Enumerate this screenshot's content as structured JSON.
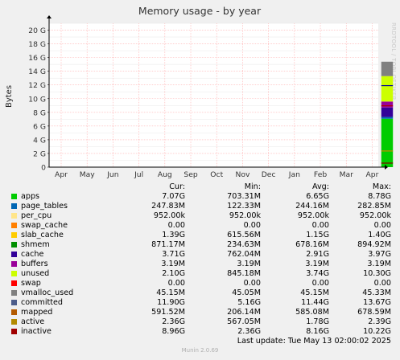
{
  "title": "Memory usage - by year",
  "ylabel": "Bytes",
  "watermark": "RRDTOOL / TOBI OETIKER",
  "chart_data": {
    "type": "area",
    "title": "Memory usage - by year",
    "ylabel": "Bytes",
    "ylim": [
      0,
      21
    ],
    "y_ticks": [
      "0",
      "2 G",
      "4 G",
      "6 G",
      "8 G",
      "10 G",
      "12 G",
      "14 G",
      "16 G",
      "18 G",
      "20 G"
    ],
    "y_tick_values": [
      0,
      2,
      4,
      6,
      8,
      10,
      12,
      14,
      16,
      18,
      20
    ],
    "y_unit": "G",
    "x_ticks": [
      "Apr",
      "May",
      "Jun",
      "Jul",
      "Aug",
      "Sep",
      "Oct",
      "Nov",
      "Dec",
      "Jan",
      "Feb",
      "Mar",
      "Apr"
    ],
    "grid": true,
    "data_window": {
      "start_month_index": 12.35,
      "end_month_index": 12.8
    },
    "stack_at_end": [
      {
        "name": "apps",
        "color": "#00cc00",
        "value": 7.07
      },
      {
        "name": "page_tables",
        "color": "#0066b3",
        "value": 0.248
      },
      {
        "name": "per_cpu",
        "color": "#ff8000",
        "value": 0.001
      },
      {
        "name": "swap_cache",
        "color": "#ffcc00",
        "value": 0.0
      },
      {
        "name": "slab_cache",
        "color": "#330099",
        "value": 1.39
      },
      {
        "name": "shmem",
        "color": "#990099",
        "value": 0.871
      },
      {
        "name": "cache",
        "color": "#ccff00",
        "value": 3.71
      },
      {
        "name": "buffers",
        "color": "#ff0000",
        "value": 0.003
      },
      {
        "name": "unused",
        "color": "#808080",
        "value": 2.1
      }
    ],
    "lines": [
      {
        "name": "committed",
        "color": "#000099",
        "value": 11.9
      },
      {
        "name": "mapped",
        "color": "#800000",
        "value": 0.59
      },
      {
        "name": "active",
        "color": "#cc8800",
        "value": 2.36
      },
      {
        "name": "inactive",
        "color": "#aa0000",
        "value": 8.96
      }
    ]
  },
  "legend": {
    "headers": {
      "cur": "Cur:",
      "min": "Min:",
      "avg": "Avg:",
      "max": "Max:"
    },
    "rows": [
      {
        "name": "apps",
        "color": "#00cc00",
        "cur": "7.07G",
        "min": "703.31M",
        "avg": "6.65G",
        "max": "8.78G"
      },
      {
        "name": "page_tables",
        "color": "#0066b3",
        "cur": "247.83M",
        "min": "122.33M",
        "avg": "244.16M",
        "max": "282.85M"
      },
      {
        "name": "per_cpu",
        "color": "#ffe58a",
        "cur": "952.00k",
        "min": "952.00k",
        "avg": "952.00k",
        "max": "952.00k"
      },
      {
        "name": "swap_cache",
        "color": "#ff8000",
        "cur": "0.00",
        "min": "0.00",
        "avg": "0.00",
        "max": "0.00"
      },
      {
        "name": "slab_cache",
        "color": "#ffcc00",
        "cur": "1.39G",
        "min": "615.56M",
        "avg": "1.15G",
        "max": "1.40G"
      },
      {
        "name": "shmem",
        "color": "#008f00",
        "cur": "871.17M",
        "min": "234.63M",
        "avg": "678.16M",
        "max": "894.92M"
      },
      {
        "name": "cache",
        "color": "#330099",
        "cur": "3.71G",
        "min": "762.04M",
        "avg": "2.91G",
        "max": "3.97G"
      },
      {
        "name": "buffers",
        "color": "#990099",
        "cur": "3.19M",
        "min": "3.19M",
        "avg": "3.19M",
        "max": "3.19M"
      },
      {
        "name": "unused",
        "color": "#ccff00",
        "cur": "2.10G",
        "min": "845.18M",
        "avg": "3.74G",
        "max": "10.30G"
      },
      {
        "name": "swap",
        "color": "#ff0000",
        "cur": "0.00",
        "min": "0.00",
        "avg": "0.00",
        "max": "0.00"
      },
      {
        "name": "vmalloc_used",
        "color": "#808080",
        "cur": "45.15M",
        "min": "45.05M",
        "avg": "45.15M",
        "max": "45.33M"
      },
      {
        "name": "committed",
        "color": "#4d5d8a",
        "cur": "11.90G",
        "min": "5.16G",
        "avg": "11.44G",
        "max": "13.67G"
      },
      {
        "name": "mapped",
        "color": "#b35a00",
        "cur": "591.52M",
        "min": "206.14M",
        "avg": "585.08M",
        "max": "678.59M"
      },
      {
        "name": "active",
        "color": "#b38a00",
        "cur": "2.36G",
        "min": "567.05M",
        "avg": "1.78G",
        "max": "2.39G"
      },
      {
        "name": "inactive",
        "color": "#a00000",
        "cur": "8.96G",
        "min": "2.36G",
        "avg": "8.16G",
        "max": "10.22G"
      }
    ]
  },
  "last_update": "Last update: Tue May 13 02:00:02 2025",
  "footer": "Munin 2.0.69"
}
